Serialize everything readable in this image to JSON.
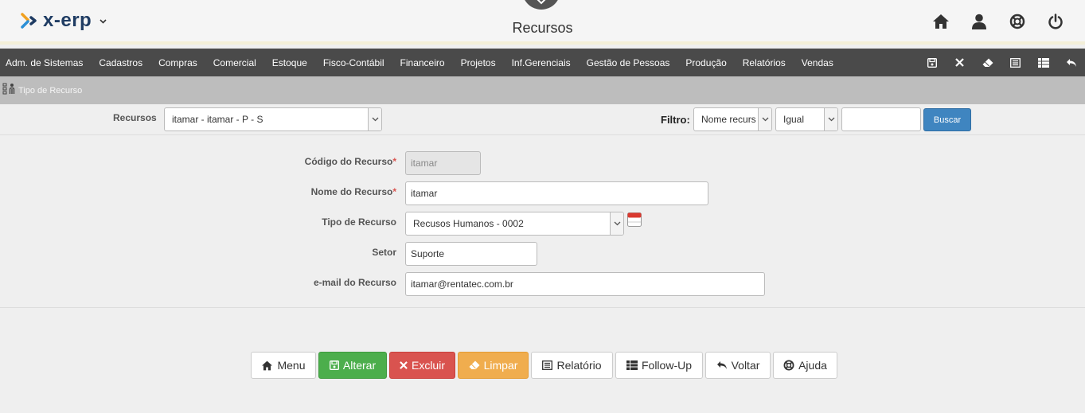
{
  "header": {
    "logo_text": "x-erp",
    "page_title": "Recursos"
  },
  "menu": {
    "items": [
      "Adm. de Sistemas",
      "Cadastros",
      "Compras",
      "Comercial",
      "Estoque",
      "Fisco-Contábil",
      "Financeiro",
      "Projetos",
      "Inf.Gerenciais",
      "Gestão de Pessoas",
      "Produção",
      "Relatórios",
      "Vendas"
    ]
  },
  "breadcrumb": {
    "text": "Tipo de Recurso"
  },
  "filter": {
    "recursos_label": "Recursos",
    "recursos_value": "itamar - itamar - P - S",
    "filtro_label": "Filtro:",
    "field_value": "Nome recurs",
    "operator_value": "Igual",
    "search_value": "",
    "buscar_label": "Buscar"
  },
  "form": {
    "codigo_label": "Código do Recurso",
    "codigo_value": "itamar",
    "nome_label": "Nome do Recurso",
    "nome_value": "itamar",
    "tipo_label": "Tipo de Recurso",
    "tipo_value": "Recusos Humanos - 0002",
    "setor_label": "Setor",
    "setor_value": "Suporte",
    "email_label": "e-mail do Recurso",
    "email_value": "itamar@rentatec.com.br",
    "required_mark": "*"
  },
  "actions": {
    "menu": "Menu",
    "alterar": "Alterar",
    "excluir": "Excluir",
    "limpar": "Limpar",
    "relatorio": "Relatório",
    "followup": "Follow-Up",
    "voltar": "Voltar",
    "ajuda": "Ajuda"
  },
  "colors": {
    "menubar": "#4a4a4a",
    "breadcrumb": "#bdbdbd",
    "alterar": "#4cae4c",
    "excluir": "#d9534f",
    "limpar": "#f0ad4e",
    "buscar": "#3f85c0",
    "logo": "#1f3c63"
  }
}
